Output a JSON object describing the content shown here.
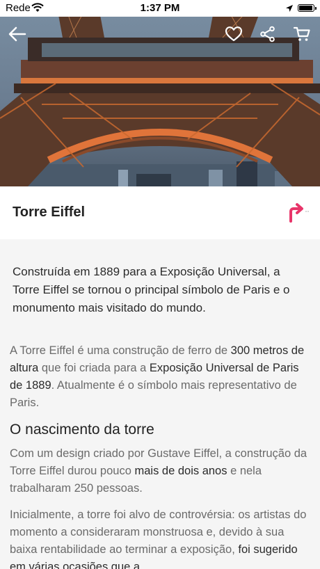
{
  "status_bar": {
    "carrier": "Rede",
    "time": "1:37 PM",
    "battery_level": 0.9
  },
  "header": {
    "back_icon": "arrow-left-icon",
    "favorite_icon": "heart-icon",
    "share_icon": "share-icon",
    "cart_icon": "cart-icon"
  },
  "title": "Torre Eiffel",
  "directions_icon": "turn-right-arrow-icon",
  "colors": {
    "accent": "#e8356a",
    "background": "#f5f5f5"
  },
  "intro": "Construída em 1889 para a Exposição Universal, a Torre Eiffel se tornou o principal símbolo de Paris e o monumento mais visitado do mundo.",
  "paragraph1": {
    "t1": "A Torre Eiffel é uma construção de ferro de ",
    "b1": "300 metros de altura",
    "t2": " que foi criada para a ",
    "b2": "Exposição Universal de Paris de 1889",
    "t3": ". Atualmente é o símbolo mais representativo de Paris."
  },
  "heading": "O nascimento da torre",
  "paragraph2": {
    "t1": "Com um design criado por Gustave Eiffel, a construção da Torre Eiffel durou pouco ",
    "b1": "mais de dois anos",
    "t2": " e nela trabalharam 250 pessoas."
  },
  "paragraph3": {
    "t1": "Inicialmente, a torre foi alvo de controvérsia: os artistas do momento a consideraram monstruosa e, devido à sua baixa rentabilidade ao terminar a exposição, ",
    "b1": "foi sugerido em várias ocasiões que a"
  }
}
